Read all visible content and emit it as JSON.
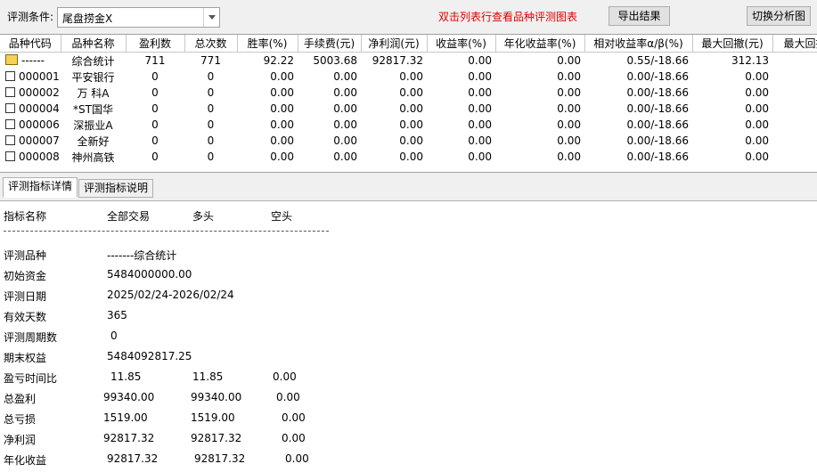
{
  "toolbar": {
    "condition_label": "评测条件:",
    "condition_value": "尾盘捞金X",
    "hint": "双击列表行查看品种评测图表",
    "export_label": "导出结果",
    "switch_label": "切换分析图"
  },
  "table": {
    "headers": [
      "品种代码",
      "品种名称",
      "盈利数",
      "总次数",
      "胜率(%)",
      "手续费(元)",
      "净利润(元)",
      "收益率(%)",
      "年化收益率(%)",
      "相对收益率α/β(%)",
      "最大回撤(元)",
      "最大回撤"
    ],
    "rows": [
      {
        "code": "------",
        "name": "综合统计",
        "win": "711",
        "total": "771",
        "rate": "92.22",
        "fee": "5003.68",
        "profit": "92817.32",
        "ret": "0.00",
        "annual": "0.00",
        "rel": "0.55/-18.66",
        "dd": "312.13"
      },
      {
        "code": "000001",
        "name": "平安银行",
        "win": "0",
        "total": "0",
        "rate": "0.00",
        "fee": "0.00",
        "profit": "0.00",
        "ret": "0.00",
        "annual": "0.00",
        "rel": "0.00/-18.66",
        "dd": "0.00"
      },
      {
        "code": "000002",
        "name": "万 科A",
        "win": "0",
        "total": "0",
        "rate": "0.00",
        "fee": "0.00",
        "profit": "0.00",
        "ret": "0.00",
        "annual": "0.00",
        "rel": "0.00/-18.66",
        "dd": "0.00"
      },
      {
        "code": "000004",
        "name": "*ST国华",
        "win": "0",
        "total": "0",
        "rate": "0.00",
        "fee": "0.00",
        "profit": "0.00",
        "ret": "0.00",
        "annual": "0.00",
        "rel": "0.00/-18.66",
        "dd": "0.00"
      },
      {
        "code": "000006",
        "name": "深振业A",
        "win": "0",
        "total": "0",
        "rate": "0.00",
        "fee": "0.00",
        "profit": "0.00",
        "ret": "0.00",
        "annual": "0.00",
        "rel": "0.00/-18.66",
        "dd": "0.00"
      },
      {
        "code": "000007",
        "name": "全新好",
        "win": "0",
        "total": "0",
        "rate": "0.00",
        "fee": "0.00",
        "profit": "0.00",
        "ret": "0.00",
        "annual": "0.00",
        "rel": "0.00/-18.66",
        "dd": "0.00"
      },
      {
        "code": "000008",
        "name": "神州高铁",
        "win": "0",
        "total": "0",
        "rate": "0.00",
        "fee": "0.00",
        "profit": "0.00",
        "ret": "0.00",
        "annual": "0.00",
        "rel": "0.00/-18.66",
        "dd": "0.00"
      }
    ]
  },
  "tabs": [
    "评测指标详情",
    "评测指标说明"
  ],
  "detail": {
    "headers": [
      "指标名称",
      "全部交易",
      "多头",
      "空头"
    ],
    "separator": "------------------------------------------------------------------------",
    "lines": [
      {
        "label": "评测品种",
        "values": [
          "-------综合统计"
        ]
      },
      {
        "label": "初始资金",
        "values": [
          "5484000000.00"
        ]
      },
      {
        "label": "评测日期",
        "values": [
          "2025/02/24-2026/02/24"
        ]
      },
      {
        "label": "有效天数",
        "values": [
          "365"
        ]
      },
      {
        "label": "评测周期数",
        "values": [
          "0"
        ]
      },
      {
        "label": "期末权益",
        "values": [
          "5484092817.25"
        ]
      },
      {
        "label": "盈亏时间比",
        "values": [
          "11.85",
          "11.85",
          "0.00"
        ]
      },
      {
        "label": "总盈利",
        "values": [
          "99340.00",
          "99340.00",
          "0.00"
        ]
      },
      {
        "label": "总亏损",
        "values": [
          "1519.00",
          "1519.00",
          "0.00"
        ]
      },
      {
        "label": "净利润",
        "values": [
          "92817.32",
          "92817.32",
          "0.00"
        ]
      },
      {
        "label": "年化收益",
        "values": [
          "92817.32",
          "92817.32",
          "0.00"
        ]
      }
    ]
  },
  "colors": {
    "hint": "#e00000",
    "sum_icon": "#f4d25a"
  },
  "icons": {
    "summary_row": "folder-icon",
    "stock_row": "document-icon",
    "combo": "chevron-down-icon"
  }
}
